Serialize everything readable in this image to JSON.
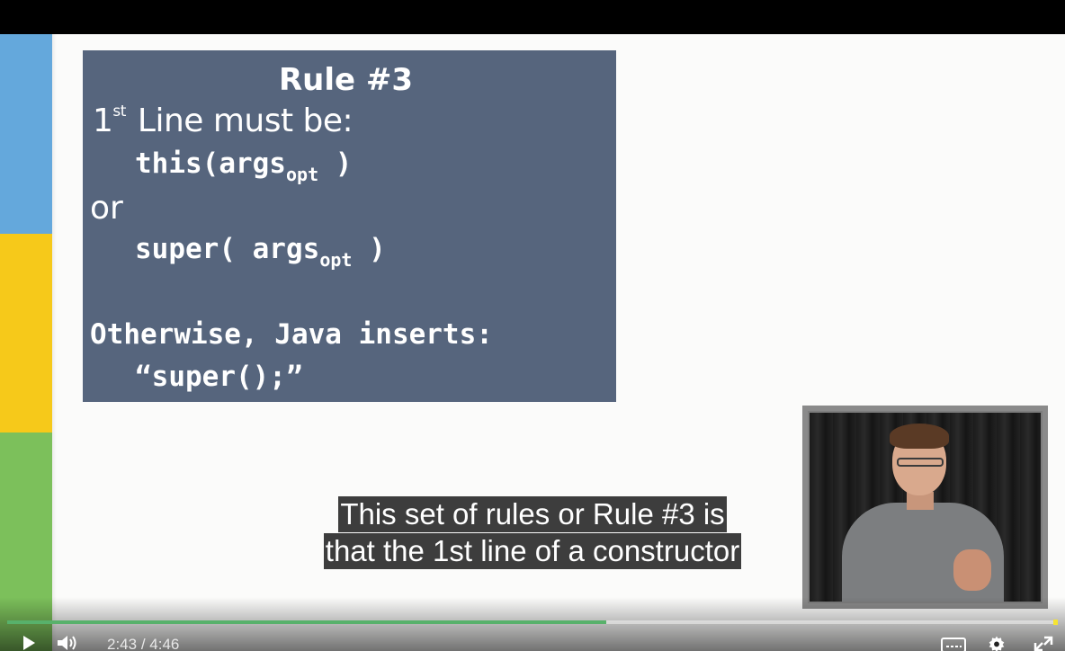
{
  "slide": {
    "title": "Rule #3",
    "line1_prefix": "1",
    "line1_sup": "st",
    "line1_text": "Line must be:",
    "code_this": "this(args",
    "code_this_sub": "opt",
    "code_this_close": " )",
    "or_text": "or",
    "code_super": "super( args",
    "code_super_sub": "opt",
    "code_super_close": " )",
    "otherwise_text": "Otherwise, Java inserts:",
    "inserted_code": "“super();”"
  },
  "captions": {
    "line1": "This set of rules or Rule #3 is",
    "line2": "that the 1st line of a constructor"
  },
  "player": {
    "current_time": "2:43",
    "separator": "/",
    "duration": "4:46",
    "progress_fraction": 0.57,
    "buffered_fraction": 0.57,
    "progress_color": "#58b16b",
    "icons": {
      "play": "play-icon",
      "volume": "volume-icon",
      "captions": "captions-icon",
      "settings": "gear-icon",
      "fullscreen": "fullscreen-icon"
    }
  },
  "colors": {
    "slide_box": "#56657d",
    "stripe_blue": "#64a8dc",
    "stripe_yellow": "#f6c91a",
    "stripe_green": "#7cc05b"
  }
}
